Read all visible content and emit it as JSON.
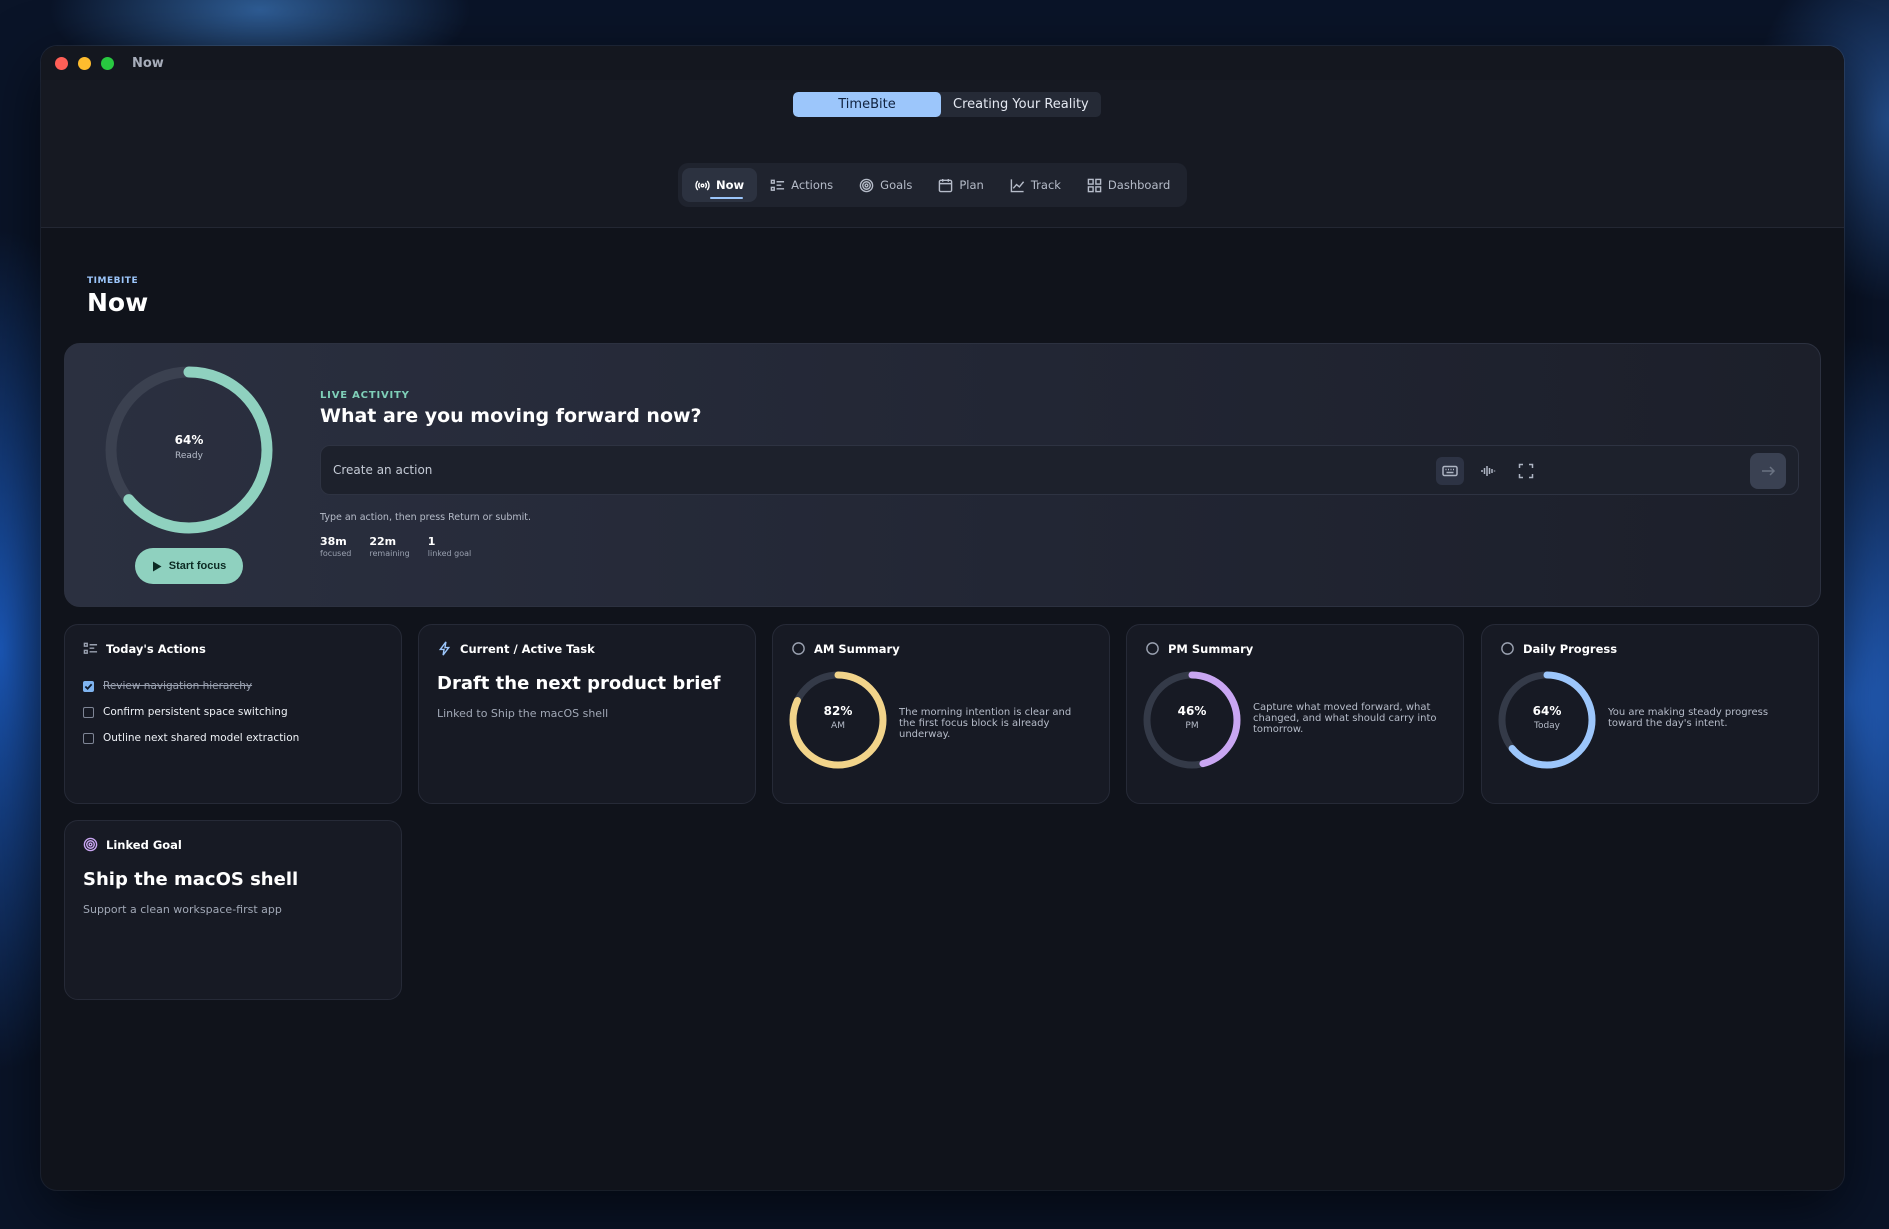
{
  "window": {
    "title": "Now"
  },
  "spaces": {
    "items": [
      "TimeBite",
      "Creating Your Reality"
    ],
    "active": "TimeBite"
  },
  "tabs": [
    {
      "label": "Now",
      "icon": "broadcast-icon"
    },
    {
      "label": "Actions",
      "icon": "list-icon"
    },
    {
      "label": "Goals",
      "icon": "target-icon"
    },
    {
      "label": "Plan",
      "icon": "calendar-icon"
    },
    {
      "label": "Track",
      "icon": "chart-line-icon"
    },
    {
      "label": "Dashboard",
      "icon": "grid-icon"
    }
  ],
  "page": {
    "eyebrow": "TIMEBITE",
    "title": "Now"
  },
  "hero": {
    "ring": {
      "percent_label": "64%",
      "percent": 64,
      "label": "Ready",
      "color": "#8fd1bf"
    },
    "start_label": "Start focus",
    "eyebrow": "LIVE ACTIVITY",
    "title": "What are you moving forward now?",
    "input_placeholder": "Create an action",
    "hint": "Type an action, then press Return or submit.",
    "stats": [
      {
        "value": "38m",
        "label": "focused"
      },
      {
        "value": "22m",
        "label": "remaining"
      },
      {
        "value": "1",
        "label": "linked goal"
      }
    ]
  },
  "todays_actions": {
    "title": "Today's Actions",
    "items": [
      {
        "label": "Review navigation hierarchy",
        "done": true
      },
      {
        "label": "Confirm persistent space switching",
        "done": false
      },
      {
        "label": "Outline next shared model extraction",
        "done": false
      }
    ]
  },
  "current_task": {
    "header": "Current / Active Task",
    "title": "Draft the next product brief",
    "subtitle": "Linked to Ship the macOS shell"
  },
  "am_summary": {
    "header": "AM Summary",
    "percent_label": "82%",
    "percent": 82,
    "label": "AM",
    "color": "#f2d48a",
    "text": "The morning intention is clear and the first focus block is already underway."
  },
  "pm_summary": {
    "header": "PM Summary",
    "percent_label": "46%",
    "percent": 46,
    "label": "PM",
    "color": "#c9a6f2",
    "text": "Capture what moved forward, what changed, and what should carry into tomorrow."
  },
  "daily_progress": {
    "header": "Daily Progress",
    "percent_label": "64%",
    "percent": 64,
    "label": "Today",
    "color": "#9cc6fb",
    "text": "You are making steady progress toward the day's intent."
  },
  "linked_goal": {
    "header": "Linked Goal",
    "title": "Ship the macOS shell",
    "subtitle": "Support a clean workspace-first app"
  }
}
